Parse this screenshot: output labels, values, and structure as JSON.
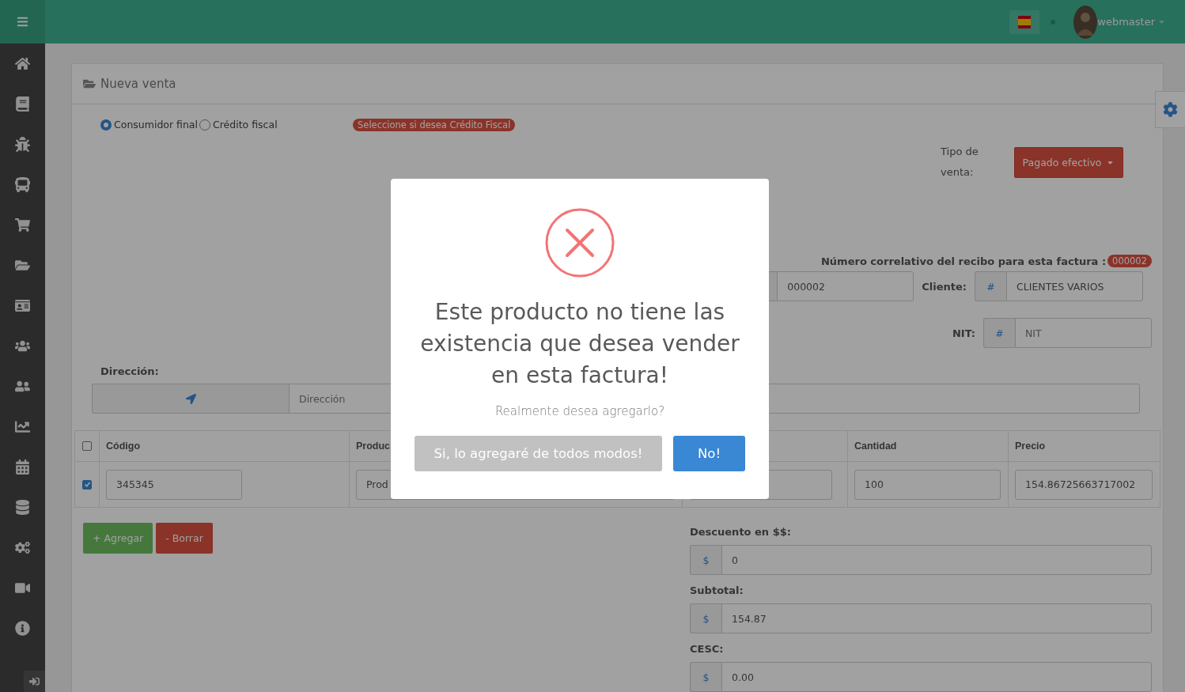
{
  "topbar": {
    "user": "webmaster"
  },
  "panel": {
    "title": "Nueva venta"
  },
  "customer_type": [
    {
      "label": "Consumidor final",
      "selected": true
    },
    {
      "label": "Crédito fiscal",
      "selected": false
    }
  ],
  "customer_type_hint": "Seleccione si desea Crédito Fiscal",
  "sale_type": {
    "label": "Tipo de venta:",
    "value": "Pagado efectivo"
  },
  "receipt_number": {
    "label": "Número correlativo del recibo para esta factura :",
    "value": "000002"
  },
  "invoice_field": {
    "value": "000002"
  },
  "client": {
    "label": "Cliente:",
    "addon": "#",
    "value": "CLIENTES VARIOS"
  },
  "nit": {
    "label": "NIT:",
    "addon": "#",
    "placeholder": "NIT"
  },
  "address": {
    "label": "Dirección:",
    "placeholder": "Dirección"
  },
  "table": {
    "header_checked": false,
    "columns": [
      "Código",
      "Produc",
      "Cantidad",
      "Precio"
    ],
    "rows": [
      {
        "checked": true,
        "cells": [
          "345345",
          "Prod",
          "100",
          "154.86725663717002"
        ]
      }
    ]
  },
  "buttons": {
    "add": "+ Agregar",
    "delete": "- Borrar"
  },
  "totals": [
    {
      "label": "Descuento en $$:",
      "addon": "$",
      "value": "0"
    },
    {
      "label": "Subtotal:",
      "addon": "$",
      "value": "154.87"
    },
    {
      "label": "CESC:",
      "addon": "$",
      "value": "0.00"
    }
  ],
  "dialog": {
    "title": "Este producto no tiene las existencia que desea vender en esta factura!",
    "text": "Realmente desea agregarlo?",
    "confirm": "Si, lo agregaré de todos modos!",
    "cancel": "No!"
  }
}
